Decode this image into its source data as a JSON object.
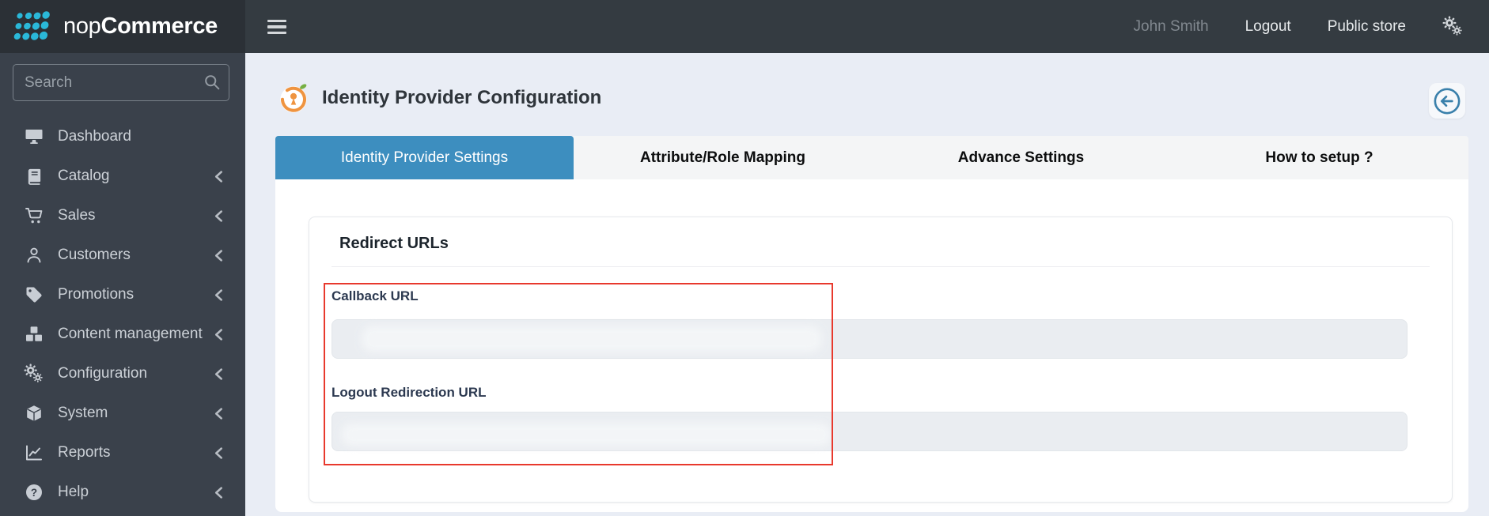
{
  "topbar": {
    "brand_nop": "nop",
    "brand_commerce": "Commerce",
    "user_name": "John Smith",
    "logout_label": "Logout",
    "public_store_label": "Public store"
  },
  "sidebar": {
    "search_placeholder": "Search",
    "items": [
      {
        "label": "Dashboard",
        "icon": "desktop-icon",
        "has_submenu": false
      },
      {
        "label": "Catalog",
        "icon": "book-icon",
        "has_submenu": true
      },
      {
        "label": "Sales",
        "icon": "cart-icon",
        "has_submenu": true
      },
      {
        "label": "Customers",
        "icon": "user-icon",
        "has_submenu": true
      },
      {
        "label": "Promotions",
        "icon": "tag-icon",
        "has_submenu": true
      },
      {
        "label": "Content management",
        "icon": "cubes-icon",
        "has_submenu": true
      },
      {
        "label": "Configuration",
        "icon": "gears-icon",
        "has_submenu": true
      },
      {
        "label": "System",
        "icon": "cube-icon",
        "has_submenu": true
      },
      {
        "label": "Reports",
        "icon": "chart-line-icon",
        "has_submenu": true
      },
      {
        "label": "Help",
        "icon": "question-circle-icon",
        "has_submenu": true
      }
    ]
  },
  "main": {
    "page_title": "Identity Provider Configuration",
    "tabs": [
      {
        "label": "Identity Provider Settings",
        "active": true
      },
      {
        "label": "Attribute/Role Mapping",
        "active": false
      },
      {
        "label": "Advance Settings",
        "active": false
      },
      {
        "label": "How to setup ?",
        "active": false
      }
    ],
    "redirect_urls": {
      "heading": "Redirect URLs",
      "fields": [
        {
          "label": "Callback URL",
          "value": "",
          "state": "disabled-redacted"
        },
        {
          "label": "Logout Redirection URL",
          "value": "",
          "state": "disabled-redacted"
        }
      ]
    }
  },
  "colors": {
    "topbar_bg": "#343b41",
    "brand_bg": "#2b3036",
    "sidebar_bg": "#3a414b",
    "main_bg": "#e9edf5",
    "active_tab_blue": "#3d8ebf",
    "highlight_red": "#e8392d",
    "brand_teal": "#2ab8d9",
    "provider_icon_orange": "#ef9440",
    "provider_icon_green": "#76b043",
    "back_icon_blue": "#3a80ab"
  }
}
